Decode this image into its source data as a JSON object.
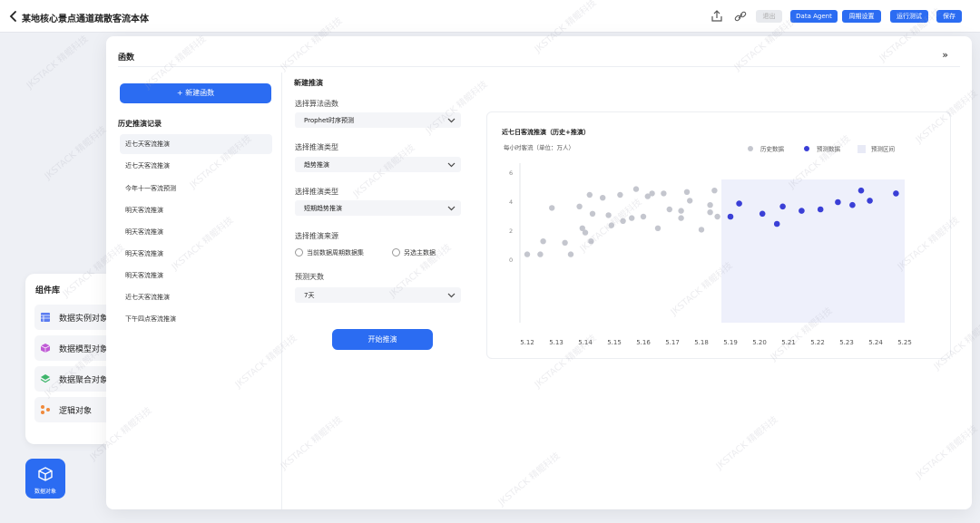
{
  "topbar": {
    "title": "某地核心景点通道疏散客流本体",
    "buttons": {
      "exit": "退出",
      "data_agent": "Data Agent",
      "period_settings": "周期设置",
      "run_test": "运行测试",
      "save": "保存"
    }
  },
  "components": {
    "title": "组件库",
    "items": [
      {
        "label": "数据实例对象",
        "icon": "table-icon"
      },
      {
        "label": "数据模型对象",
        "icon": "cube-icon"
      },
      {
        "label": "数据聚合对象",
        "icon": "stack-icon"
      },
      {
        "label": "逻辑对象",
        "icon": "logic-icon"
      }
    ]
  },
  "data_object_button": "数据对象",
  "panel": {
    "title": "函数",
    "new_function_label": "+ 新建函数",
    "history_title": "历史推演记录",
    "history": [
      "近七天客流推演",
      "近七天客流推演",
      "今年十一客流预测",
      "明天客流推演",
      "明天客流推演",
      "明天客流推演",
      "明天客流推演",
      "近七天客流推演",
      "下午四点客流推演"
    ]
  },
  "form": {
    "title": "新建推演",
    "algorithm_label": "选择算法函数",
    "algorithm_value": "Prophet时序预测",
    "type_label": "选择推演类型",
    "type_value": "趋势推演",
    "type2_label": "选择推演类型",
    "type2_value": "短期趋势推演",
    "source_label": "选择推演来源",
    "source_option_1": "当前数据周期数据集",
    "source_option_2": "另选主数据",
    "days_label": "预测天数",
    "days_value": "7天",
    "start_label": "开始推演"
  },
  "chart_data": {
    "type": "scatter",
    "title": "近七日客流推演（历史+推演）",
    "ylabel": "每小时客流（单位：万人）",
    "categories": [
      "5.12",
      "5.13",
      "5.14",
      "5.15",
      "5.16",
      "5.17",
      "5.18",
      "5.19",
      "5.20",
      "5.21",
      "5.22",
      "5.23",
      "5.24",
      "5.25"
    ],
    "ylim": [
      0,
      6
    ],
    "yticks": [
      0,
      2,
      4,
      6
    ],
    "legend": [
      "历史数据",
      "预测数据",
      "预测区间"
    ],
    "legend_position": "top-right",
    "prediction_region": [
      "5.19",
      "5.25"
    ],
    "series": [
      {
        "name": "历史数据",
        "color": "#c4c6ce",
        "x": [
          12.0,
          12.45,
          12.55,
          12.85,
          13.3,
          13.5,
          13.8,
          13.9,
          14.0,
          14.15,
          14.2,
          14.25,
          14.6,
          14.8,
          14.9,
          15.2,
          15.3,
          15.6,
          15.75,
          16.0,
          16.15,
          16.3,
          16.5,
          16.7,
          16.9,
          17.3,
          17.3,
          17.5,
          17.6,
          18.0,
          18.3,
          18.3,
          18.45,
          18.55
        ],
        "y": [
          0.4,
          0.4,
          1.3,
          3.6,
          1.2,
          0.4,
          3.7,
          2.2,
          1.9,
          4.5,
          1.3,
          3.2,
          4.3,
          3.1,
          2.4,
          4.5,
          2.7,
          2.9,
          4.9,
          3.0,
          4.4,
          4.6,
          2.2,
          4.6,
          3.5,
          3.4,
          2.9,
          4.7,
          4.1,
          2.1,
          3.3,
          3.8,
          4.8,
          3.0
        ],
        "note": "approximate"
      },
      {
        "name": "预测数据",
        "color": "#3a3fd6",
        "x": [
          19.0,
          19.3,
          20.1,
          20.6,
          20.8,
          21.45,
          22.1,
          22.7,
          23.2,
          23.5,
          23.8,
          24.7
        ],
        "y": [
          3.0,
          3.9,
          3.2,
          2.5,
          3.7,
          3.4,
          3.5,
          4.0,
          3.8,
          4.8,
          4.1,
          4.6
        ]
      }
    ]
  },
  "watermark": "JKSTACK 精鲲科技"
}
